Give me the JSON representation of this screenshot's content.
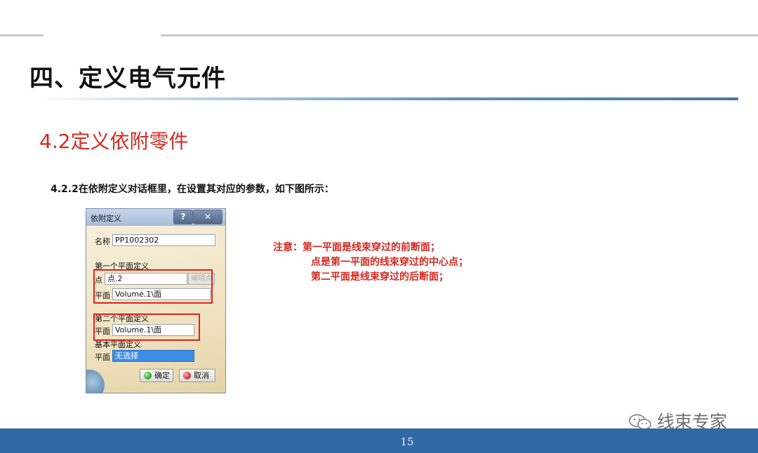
{
  "slide": {
    "title": "四、定义电气元件",
    "section": "4.2定义依附零件",
    "instruction": "4.2.2在依附定义对话框里，在设置其对应的参数，如下图所示：",
    "page_number": "15",
    "watermark": "线束专家"
  },
  "dialog": {
    "title": "依附定义",
    "help_button": "?",
    "close_button": "✕",
    "name_label": "名称",
    "name_value": "PP1002302",
    "first_plane_group": "第一个平面定义",
    "point_label": "点",
    "point_value": "点.2",
    "edit_button": "编辑点",
    "first_plane_label": "平面",
    "first_plane_value": "Volume.1\\面",
    "second_plane_group": "第二个平面定义",
    "second_plane_label": "平面",
    "second_plane_value": "Volume.1\\面",
    "base_plane_group": "基本平面定义",
    "base_plane_label": "平面",
    "base_plane_value": "无选择",
    "ok_button": "确定",
    "cancel_button": "取消"
  },
  "note": {
    "line1": "注意：第一平面是线束穿过的前断面；",
    "line2": "点是第一平面的线束穿过的中心点；",
    "line3": "第二平面是线束穿过的后断面；"
  },
  "colors": {
    "accent_red": "#d42a22",
    "footer_blue": "#2f69a6",
    "highlight_red": "#e02020"
  }
}
